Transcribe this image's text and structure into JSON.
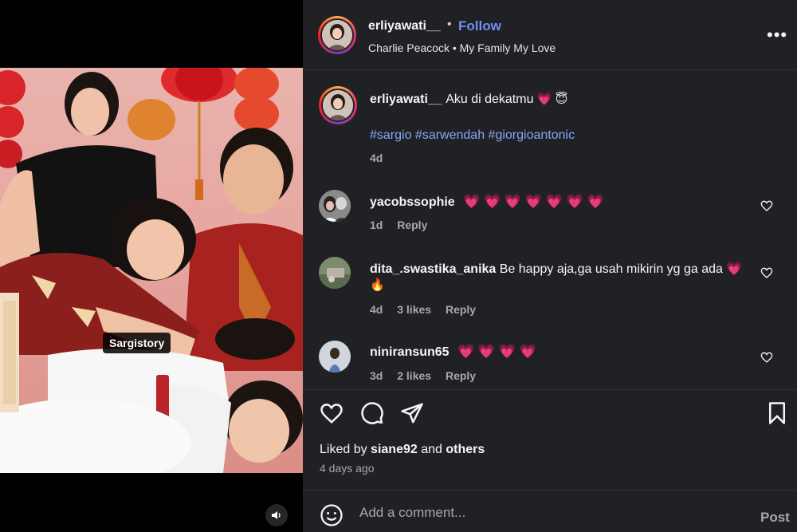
{
  "media": {
    "tag_label": "Sargistory"
  },
  "header": {
    "username": "erliyawati__",
    "separator": "•",
    "follow_label": "Follow",
    "audio": "Charlie Peacock • My Family My Love",
    "more_label": "•••"
  },
  "caption": {
    "username": "erliyawati__",
    "text": "Aku di dekatmu",
    "emojis": "💗 😇",
    "hashtags": "#sargio #sarwendah #giorgioantonic",
    "age": "4d"
  },
  "comments": [
    {
      "username": "yacobssophie",
      "text": "💗 💗 💗 💗 💗 💗 💗",
      "age": "1d",
      "likes": "",
      "reply_label": "Reply"
    },
    {
      "username": "dita_.swastika_anika",
      "text": "Be happy aja,ga usah mikirin yg ga ada 💗",
      "text2": "🔥",
      "age": "4d",
      "likes": "3 likes",
      "reply_label": "Reply"
    },
    {
      "username": "niniransun65",
      "text": "💗 💗 💗 💗",
      "age": "3d",
      "likes": "2 likes",
      "reply_label": "Reply"
    }
  ],
  "likes": {
    "prefix": "Liked by ",
    "user": "siane92",
    "middle": " and ",
    "others": "others",
    "time": "4 days ago"
  },
  "composer": {
    "placeholder": "Add a comment...",
    "post_label": "Post"
  },
  "colors": {
    "panel_bg": "#202124",
    "link_blue": "#6f8ff7",
    "hashtag_blue": "#8aa4f5",
    "muted": "#a8a8a8",
    "heart_pink": "#ff3e7f"
  }
}
